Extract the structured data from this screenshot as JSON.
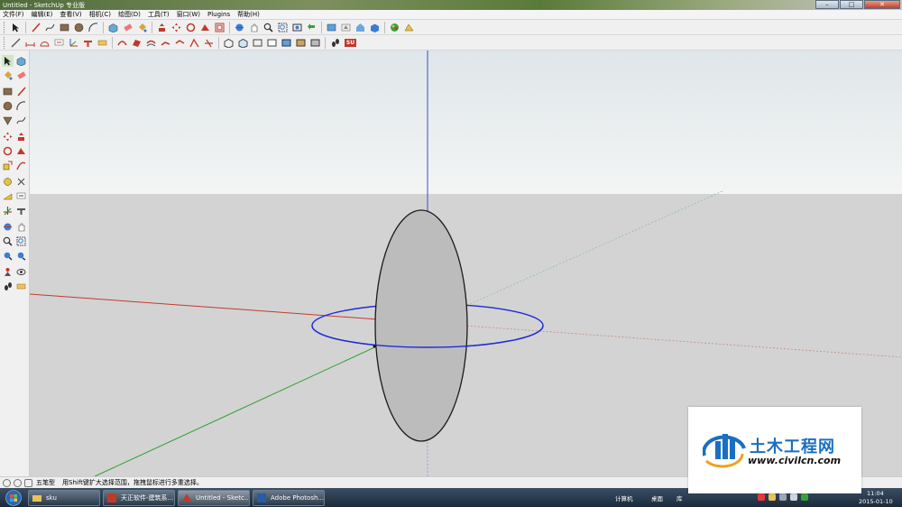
{
  "window": {
    "title": "Untitled - SketchUp 专业版",
    "minimize_label": "–",
    "maximize_label": "□",
    "close_label": "✕"
  },
  "menu": [
    "文件(F)",
    "编辑(E)",
    "查看(V)",
    "相机(C)",
    "绘图(D)",
    "工具(T)",
    "窗口(W)",
    "Plugins",
    "帮助(H)"
  ],
  "toolbar_top": {
    "row1_icons": [
      "select-icon",
      "line-icon",
      "freehand-icon",
      "rectangle-icon",
      "circle-icon",
      "arc-icon",
      "make-component-icon",
      "eraser-icon",
      "paint-bucket-icon",
      "push-pull-icon",
      "move-icon",
      "rotate-icon",
      "follow-me-icon",
      "offset-icon",
      "orbit-icon",
      "pan-icon",
      "zoom-icon",
      "zoom-window-icon",
      "zoom-extents-icon",
      "previous-view-icon",
      "get-models-icon",
      "share-model-icon",
      "warehouse-icon",
      "components-icon",
      "materials-icon",
      "styles-icon"
    ],
    "row2_icons": [
      "tape-measure-icon",
      "dimension-icon",
      "protractor-icon",
      "text-icon",
      "axes-icon",
      "3d-text-icon",
      "section-plane-icon",
      "smoove-icon",
      "stamp-icon",
      "drape-icon",
      "sandbox-from-contours-icon",
      "sandbox-from-scratch-icon",
      "add-detail-icon",
      "flip-edge-icon",
      "x-ray-icon",
      "back-edges-icon",
      "wireframe-icon",
      "hidden-line-icon",
      "shaded-icon",
      "shaded-textures-icon",
      "monochrome-icon",
      "walk-icon",
      "position-camera-icon",
      "look-around-icon",
      "sketchup-logo-icon"
    ],
    "logo_text": "SU"
  },
  "left_toolbar": {
    "icons": [
      "select-icon",
      "make-component-icon",
      "paint-bucket-icon",
      "eraser-icon",
      "rectangle-icon",
      "line-icon",
      "circle-icon",
      "arc-icon",
      "polygon-icon",
      "freehand-icon",
      "move-icon",
      "push-pull-icon",
      "rotate-icon",
      "follow-me-icon",
      "scale-icon",
      "offset-icon",
      "tape-measure-icon",
      "dimension-icon",
      "protractor-icon",
      "text-icon",
      "axes-icon",
      "3d-text-icon",
      "orbit-icon",
      "pan-icon",
      "zoom-icon",
      "zoom-window-icon",
      "zoom-extents-icon",
      "previous-view-icon",
      "position-camera-icon",
      "look-around-icon",
      "walk-icon",
      "section-plane-icon"
    ]
  },
  "colors": {
    "sky": "#e9eef0",
    "ground": "#d4d4d4",
    "red_axis": "#c0392b",
    "green_axis": "#2ea02e",
    "blue_axis": "#3a4fbf",
    "circle_edge": "#1f2bd6",
    "disc_fill": "#bdbdbd"
  },
  "status": {
    "mode_label": "五笔型",
    "hint": "用Shift键扩大选择范围，拖拽鼠标进行多重选择。"
  },
  "taskbar": {
    "items": [
      {
        "label": "sku",
        "icon": "folder-icon",
        "color": "#e7c45a"
      },
      {
        "label": "天正软件-建筑系...",
        "icon": "tangent-icon",
        "color": "#c0392b"
      },
      {
        "label": "Untitled - Sketc...",
        "icon": "sketchup-icon",
        "color": "#c0392b"
      },
      {
        "label": "Adobe Photosh...",
        "icon": "photoshop-icon",
        "color": "#2b5aa6"
      }
    ],
    "tray_labels": [
      "计算机",
      "桌面",
      "库"
    ],
    "time": "11:04",
    "date": "2015-01-10"
  },
  "watermark": {
    "title": "土木工程网",
    "url": "www.civilcn.com"
  }
}
